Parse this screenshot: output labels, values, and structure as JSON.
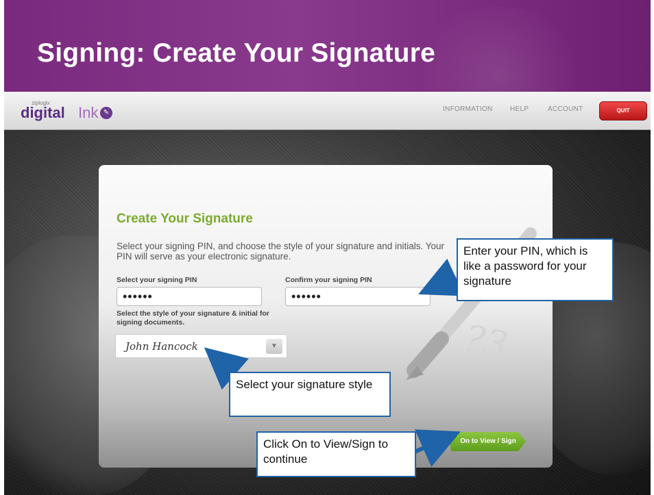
{
  "slide": {
    "title": "Signing: Create Your Signature"
  },
  "navbar": {
    "logo_small": "ziplogix",
    "logo_digital": "digital",
    "logo_ink": "Ink",
    "links": [
      "INFORMATION",
      "HELP",
      "ACCOUNT"
    ],
    "quit_label": "QUIT"
  },
  "form": {
    "title": "Create Your Signature",
    "description": "Select your signing PIN, and choose the style of your signature and initials. Your PIN will serve as your electronic signature.",
    "pin_label": "Select your signing PIN",
    "pin_value": "••••••",
    "confirm_label": "Confirm your signing PIN",
    "confirm_value": "••••••",
    "style_label": "Select the style of your signature & initial for signing documents.",
    "style_value": "John Hancock",
    "submit_label": "On to View / Sign"
  },
  "callouts": {
    "pin": "Enter your PIN, which is like a password for your signature",
    "style": "Select your signature style",
    "sign": "Click On to View/Sign to continue"
  },
  "colors": {
    "title_bar": "#7a2a7e",
    "accent_green": "#7cab2e",
    "callout_border": "#1f63a8",
    "quit_red": "#d42a2a"
  }
}
